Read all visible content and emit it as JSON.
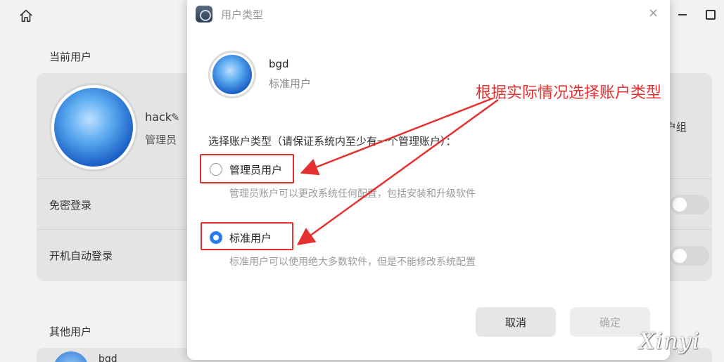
{
  "background": {
    "section_current_user": "当前用户",
    "current_user_name": "hack",
    "current_user_role": "管理员",
    "row_passwordless_login": "免密登录",
    "row_auto_login": "开机自动登录",
    "group_fragment": "户组",
    "section_other_users": "其他用户",
    "other_user_name": "bgd"
  },
  "dialog": {
    "title": "用户类型",
    "close_glyph": "×",
    "user_name": "bgd",
    "user_role": "标准用户",
    "prompt": "选择账户类型（请保证系统内至少有一个管理账户）：",
    "options": [
      {
        "label": "管理员用户",
        "description": "管理员账户可以更改系统任何配置，包括安装和升级软件",
        "selected": false
      },
      {
        "label": "标准用户",
        "description": "标准用户可以使用绝大多数软件，但是不能修改系统配置",
        "selected": true
      }
    ],
    "cancel_label": "取消",
    "confirm_label": "确定"
  },
  "annotation": {
    "text": "根据实际情况选择账户类型",
    "color": "#e53030"
  },
  "watermark": "Xinyi",
  "colors": {
    "accent": "#2a7cf6",
    "annotation_red": "#e53030"
  }
}
